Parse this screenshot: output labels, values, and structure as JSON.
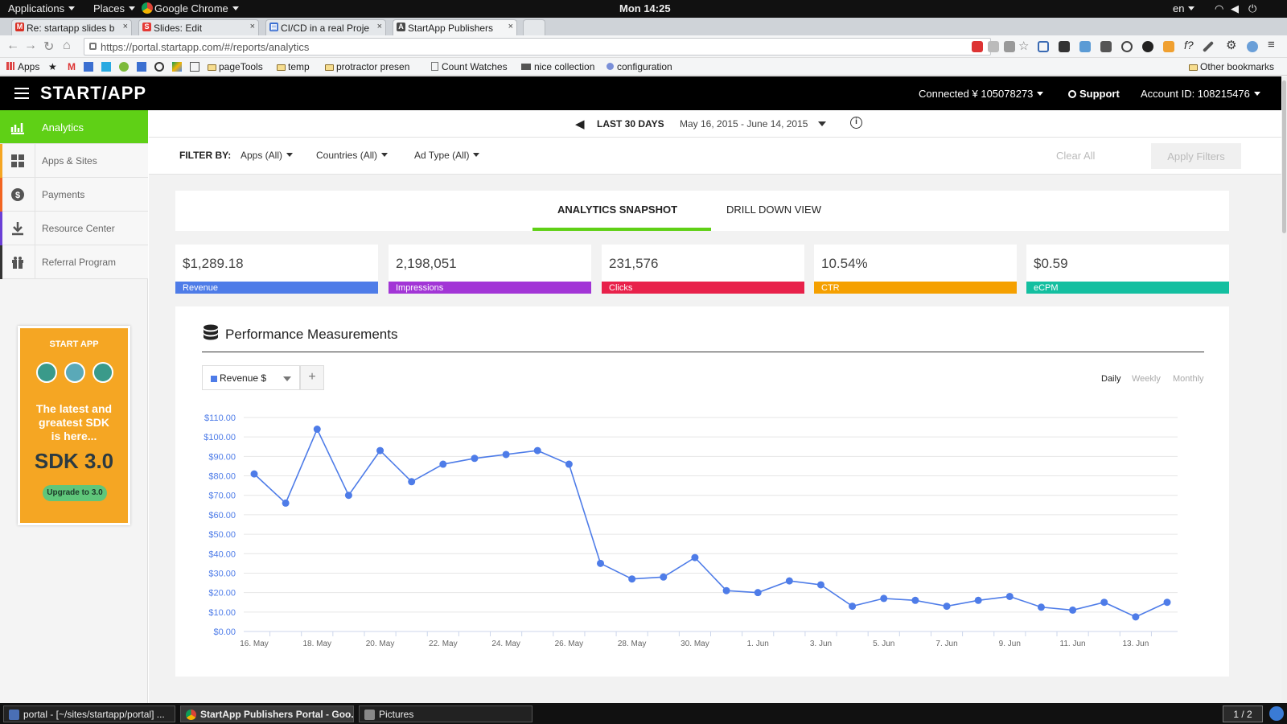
{
  "system_bar": {
    "applications": "Applications",
    "places": "Places",
    "browser": "Google Chrome",
    "clock": "Mon 14:25",
    "lang": "en"
  },
  "tabs": [
    {
      "label": "Re: startapp slides b",
      "icon_color": "#d93025",
      "icon": "M"
    },
    {
      "label": "Slides: Edit",
      "icon_color": "#e53935",
      "icon": "S"
    },
    {
      "label": "CI/CD in a real Proje",
      "icon_color": "#3b6fd1",
      "icon": "▤"
    },
    {
      "label": "StartApp Publishers",
      "icon_color": "#4a4a4a",
      "icon": "A"
    }
  ],
  "address_bar": {
    "url": "https://portal.startapp.com/#/reports/analytics"
  },
  "bookmarks": [
    {
      "label": "Apps"
    },
    {
      "label": "pageTools"
    },
    {
      "label": "temp"
    },
    {
      "label": "protractor presen"
    },
    {
      "label": "Count Watches"
    },
    {
      "label": "nice collection"
    },
    {
      "label": "configuration"
    }
  ],
  "bookmarks_other": "Other bookmarks",
  "topnav": {
    "logo": "START/APP",
    "connected": "Connected  ¥ 105078273",
    "support": "Support",
    "account": "Account ID: 108215476"
  },
  "sidebar": {
    "items": [
      {
        "label": "Analytics",
        "color": "#5fd016"
      },
      {
        "label": "Apps & Sites",
        "color": "#f5a623"
      },
      {
        "label": "Payments",
        "color": "#f26522"
      },
      {
        "label": "Resource Center",
        "color": "#6b3fd6"
      },
      {
        "label": "Referral Program",
        "color": "#333333"
      }
    ]
  },
  "ad": {
    "logo": "START APP",
    "headline_1": "The latest and",
    "headline_2": "greatest SDK",
    "headline_3": "is here...",
    "sdk": "SDK 3.0",
    "button": "Upgrade to 3.0"
  },
  "date_range": {
    "label": "LAST 30 DAYS",
    "range": "May 16, 2015 - June 14, 2015"
  },
  "filters": {
    "filter_by": "FILTER BY:",
    "apps": "Apps (All)",
    "countries": "Countries (All)",
    "ad_type": "Ad Type (All)",
    "clear": "Clear All",
    "apply": "Apply Filters"
  },
  "view_tabs": {
    "snapshot": "ANALYTICS SNAPSHOT",
    "drilldown": "DRILL DOWN VIEW"
  },
  "kpis": [
    {
      "value": "$1,289.18",
      "label": "Revenue",
      "color": "#4e7ce8"
    },
    {
      "value": "2,198,051",
      "label": "Impressions",
      "color": "#a235d6"
    },
    {
      "value": "231,576",
      "label": "Clicks",
      "color": "#e8214a"
    },
    {
      "value": "10.54%",
      "label": "CTR",
      "color": "#f5a000"
    },
    {
      "value": "$0.59",
      "label": "eCPM",
      "color": "#13bfa0"
    }
  ],
  "performance": {
    "title": "Performance Measurements",
    "metric": "Revenue $",
    "granularity": [
      "Daily",
      "Weekly",
      "Monthly"
    ]
  },
  "chart_data": {
    "type": "line",
    "title": "",
    "xlabel": "",
    "ylabel": "",
    "ylim": [
      0,
      110
    ],
    "grid": true,
    "y_ticks": [
      "$0.00",
      "$10.00",
      "$20.00",
      "$30.00",
      "$40.00",
      "$50.00",
      "$60.00",
      "$70.00",
      "$80.00",
      "$90.00",
      "$100.00",
      "$110.00"
    ],
    "x_tick_labels": [
      "16. May",
      "18. May",
      "20. May",
      "22. May",
      "24. May",
      "26. May",
      "28. May",
      "30. May",
      "1. Jun",
      "3. Jun",
      "5. Jun",
      "7. Jun",
      "9. Jun",
      "11. Jun",
      "13. Jun"
    ],
    "color": "#4e7ce8",
    "x": [
      "2015-05-16",
      "2015-05-17",
      "2015-05-18",
      "2015-05-19",
      "2015-05-20",
      "2015-05-21",
      "2015-05-22",
      "2015-05-23",
      "2015-05-24",
      "2015-05-25",
      "2015-05-26",
      "2015-05-27",
      "2015-05-28",
      "2015-05-29",
      "2015-05-30",
      "2015-05-31",
      "2015-06-01",
      "2015-06-02",
      "2015-06-03",
      "2015-06-04",
      "2015-06-05",
      "2015-06-06",
      "2015-06-07",
      "2015-06-08",
      "2015-06-09",
      "2015-06-10",
      "2015-06-11",
      "2015-06-12",
      "2015-06-13",
      "2015-06-14"
    ],
    "values": [
      81,
      66,
      104,
      70,
      93,
      77,
      86,
      89,
      91,
      93,
      86,
      35,
      27,
      28,
      38,
      21,
      20,
      26,
      24,
      13,
      17,
      16,
      13,
      16,
      18,
      12.5,
      11,
      15,
      7.5,
      15
    ]
  },
  "taskbar": {
    "items": [
      "portal - [~/sites/startapp/portal] ...",
      "StartApp Publishers Portal - Goo...",
      "Pictures"
    ],
    "pager": "1 / 2"
  }
}
